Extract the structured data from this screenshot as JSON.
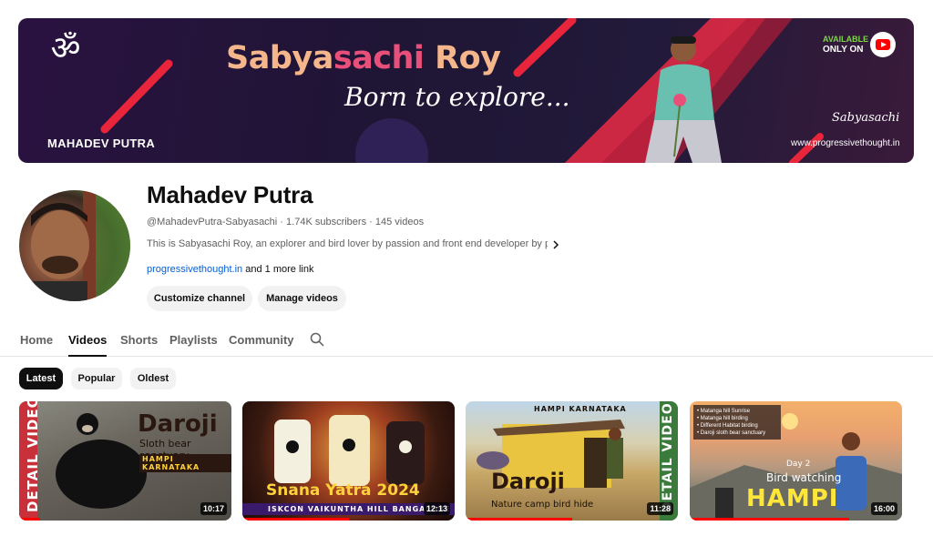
{
  "banner": {
    "title_part1": "Sabya",
    "title_part2": "sachi",
    "title_part3": " Roy",
    "tagline": "Born to explore...",
    "channel_name": "MAHADEV PUTRA",
    "available_line1": "AVAILABLE",
    "available_line2": "ONLY ON",
    "signature": "Sabyasachi",
    "website": "www.progressivethought.in"
  },
  "channel": {
    "title": "Mahadev Putra",
    "handle": "@MahadevPutra-Sabyasachi",
    "subscribers": "1.74K subscribers",
    "videos": "145 videos",
    "separator": " · ",
    "description": "This is Sabyasachi Roy, an explorer and bird lover by passion and front end developer by pr...",
    "link": "progressivethought.in",
    "more_links": " and 1 more link",
    "customize_label": "Customize channel",
    "manage_label": "Manage videos"
  },
  "tabs": [
    {
      "label": "Home"
    },
    {
      "label": "Videos"
    },
    {
      "label": "Shorts"
    },
    {
      "label": "Playlists"
    },
    {
      "label": "Community"
    }
  ],
  "active_tab": "Videos",
  "chips": [
    {
      "label": "Latest"
    },
    {
      "label": "Popular"
    },
    {
      "label": "Oldest"
    }
  ],
  "videos": [
    {
      "duration": "10:17",
      "title_text": "Daroji",
      "subtitle_text": "Sloth bear sanctuary",
      "tag_text": "HAMPI KARNATAKA",
      "side_text": "DETAIL VIDEO",
      "watched": 0.1
    },
    {
      "duration": "12:13",
      "title_text": "Snana Yatra 2024",
      "tag_text": "ISKCON VAIKUNTHA HILL BANGALORE",
      "watched": 0.5
    },
    {
      "duration": "11:28",
      "top_text": "HAMPI KARNATAKA",
      "title_text": "Daroji",
      "subtitle_text": "Nature camp bird hide",
      "side_text": "DETAIL VIDEO",
      "watched": 0.5
    },
    {
      "duration": "16:00",
      "list": [
        "• Matanga hill Sunrise",
        "• Matanga hill birding",
        "• Different Habitat birding",
        "• Daroji sloth bear sanctuary"
      ],
      "day_text": "Day 2",
      "subtitle_text": "Bird watching",
      "title_text": "HAMPI",
      "watched": 0.75
    }
  ],
  "colors": {
    "accent_red": "#ff0000",
    "link_blue": "#065fd4",
    "chip_active": "#0f0f0f"
  },
  "icons": {
    "om": "om-icon",
    "youtube": "youtube-logo-icon",
    "search": "search-icon",
    "chevron": "chevron-right-icon"
  }
}
